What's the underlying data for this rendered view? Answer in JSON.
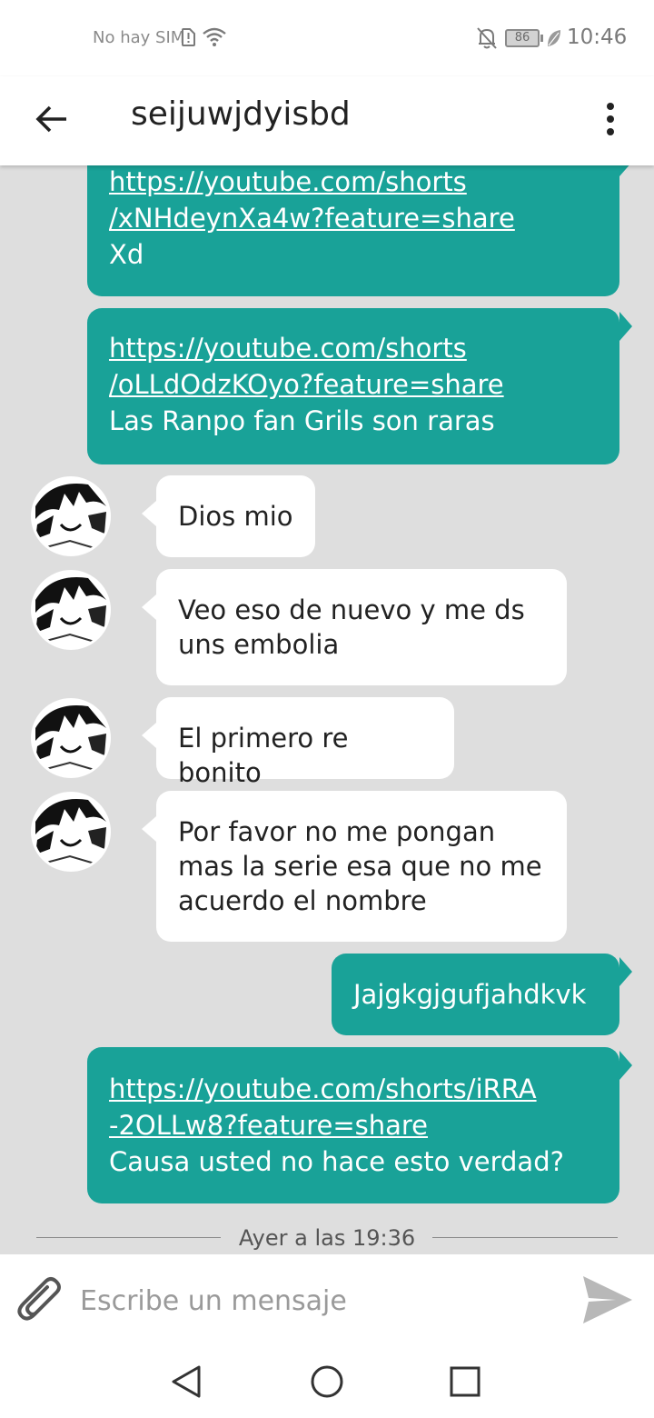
{
  "status_bar": {
    "carrier": "No hay SIM",
    "battery": "86",
    "time": "10:46"
  },
  "header": {
    "title": "seijuwjdyisbd"
  },
  "messages": [
    {
      "link1": "https://youtube.com/shorts",
      "link2": "/xNHdeynXa4w?feature=share",
      "text": "Xd"
    },
    {
      "link1": "https://youtube.com/shorts",
      "link2": "/oLLdOdzKOyo?feature=share",
      "text": "Las Ranpo fan Grils son raras"
    },
    {
      "text": "Dios mio"
    },
    {
      "line1": "Veo eso de nuevo y me ds",
      "line2": "uns embolia"
    },
    {
      "text": "El primero re bonito"
    },
    {
      "line1": "Por favor no me pongan",
      "line2": "mas la serie esa que no me",
      "line3": "acuerdo el nombre"
    },
    {
      "text": "Jajgkgjgufjahdkvk"
    },
    {
      "link1": "https://youtube.com/shorts/iRRA",
      "link2": "-2OLLw8?feature=share",
      "text": "Causa usted no hace esto verdad?"
    }
  ],
  "date_separator": "Ayer a las 19:36",
  "composer": {
    "placeholder": "Escribe un mensaje"
  },
  "colors": {
    "accent": "#19a298",
    "background": "#dedede"
  },
  "icons": [
    "arrow-back-icon",
    "more-vert-icon",
    "paperclip-icon",
    "send-icon",
    "nav-back-icon",
    "nav-home-icon",
    "nav-recents-icon"
  ]
}
